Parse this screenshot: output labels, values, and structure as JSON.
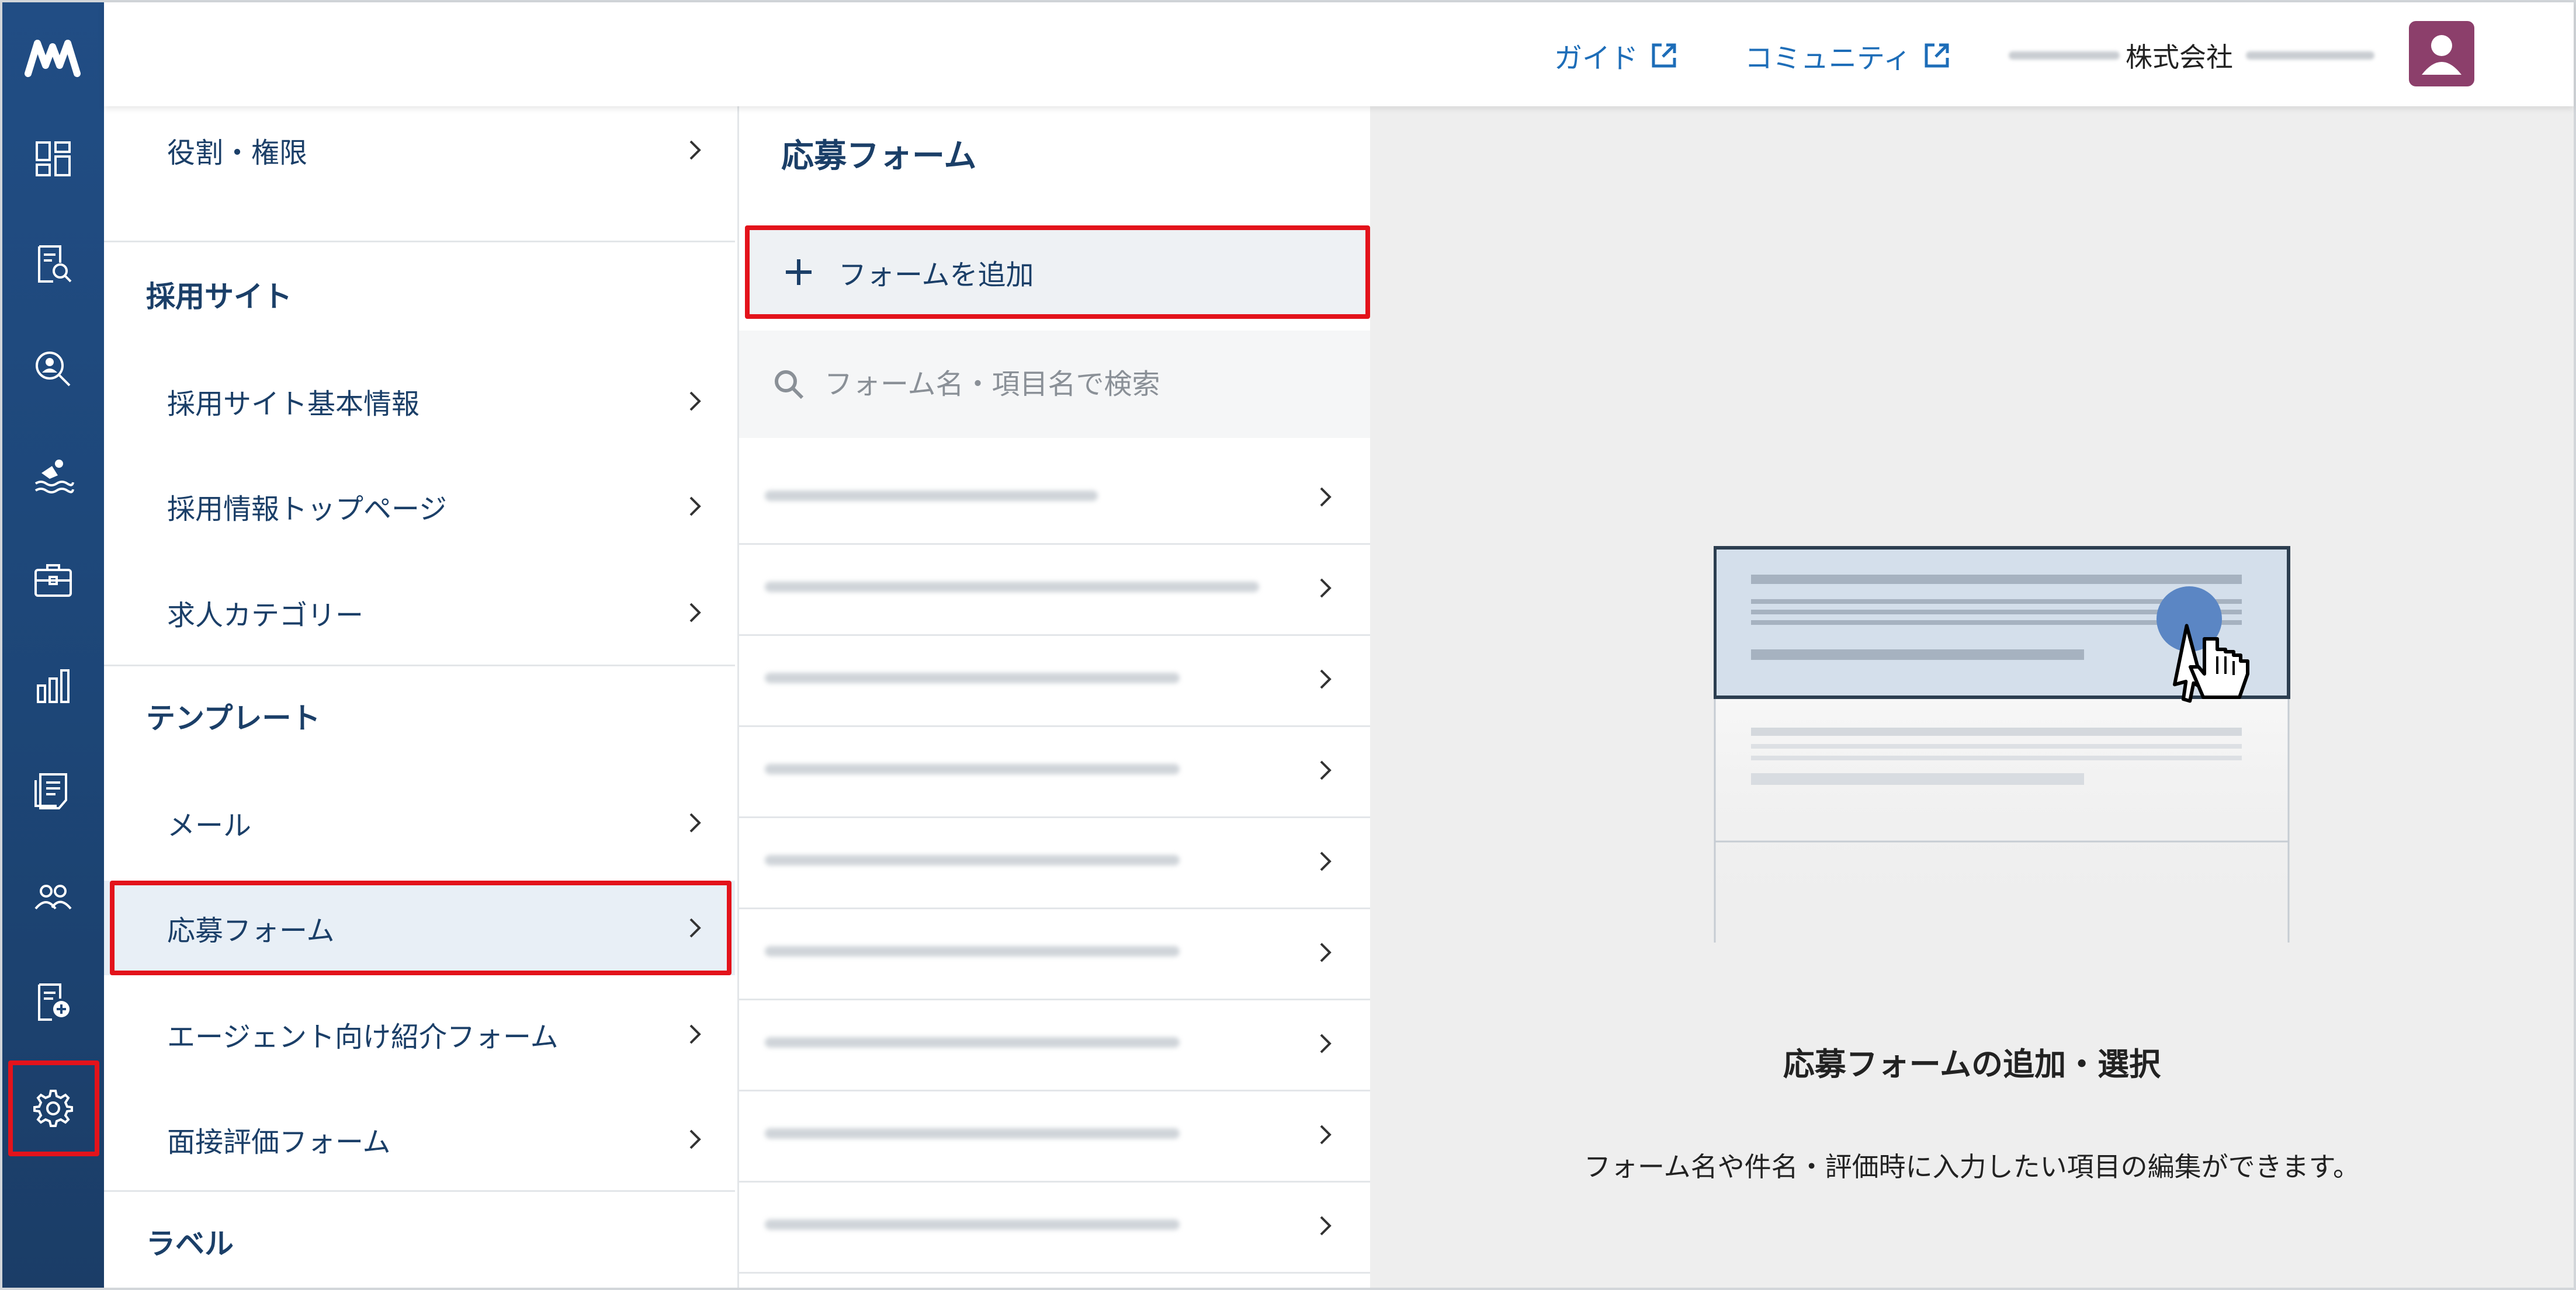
{
  "header": {
    "guide_label": "ガイド",
    "community_label": "コミュニティ",
    "company_label": "株式会社"
  },
  "menu": {
    "items_top": [
      {
        "label": "役割・権限"
      }
    ],
    "sections": [
      {
        "heading": "採用サイト",
        "items": [
          {
            "label": "採用サイト基本情報"
          },
          {
            "label": "採用情報トップページ"
          },
          {
            "label": "求人カテゴリー"
          }
        ]
      },
      {
        "heading": "テンプレート",
        "items": [
          {
            "label": "メール"
          },
          {
            "label": "応募フォーム",
            "selected": true
          },
          {
            "label": "エージェント向け紹介フォーム"
          },
          {
            "label": "面接評価フォーム"
          }
        ]
      },
      {
        "heading": "ラベル",
        "items": []
      }
    ]
  },
  "form_list": {
    "title": "応募フォーム",
    "add_label": "フォームを追加",
    "search_placeholder": "フォーム名・項目名で検索",
    "row_count": 9
  },
  "main": {
    "heading": "応募フォームの追加・選択",
    "description": "フォーム名や件名・評価時に入力したい項目の編集ができます。"
  },
  "icons": [
    "logo-icon",
    "dashboard-icon",
    "job-search-icon",
    "candidate-search-icon",
    "swimmer-icon",
    "briefcase-icon",
    "bar-chart-icon",
    "document-list-icon",
    "people-icon",
    "document-add-icon",
    "gear-icon"
  ],
  "colors": {
    "rail": "#1d4677",
    "accent": "#1d6db8",
    "highlight_border": "#e3131b",
    "text_primary": "#1b3f68"
  }
}
